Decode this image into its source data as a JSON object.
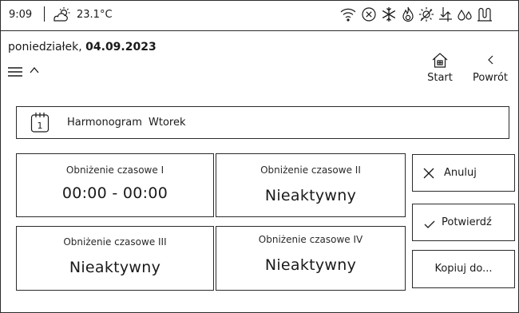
{
  "status_bar": {
    "time": "9:09",
    "temperature": "23.1°C",
    "icons": [
      "partly-sunny-icon",
      "wifi-icon",
      "error-circle-icon",
      "snowflake-icon",
      "flame-icon",
      "sun-off-icon",
      "airflow-icon",
      "water-drops-icon",
      "heat-exchanger-icon"
    ]
  },
  "header": {
    "weekday": "poniedziałek,",
    "date": "04.09.2023",
    "start_label": "Start",
    "back_label": "Powrót"
  },
  "schedule": {
    "calendar_day": "1",
    "title": "Harmonogram",
    "day": "Wtorek"
  },
  "reductions": [
    {
      "label": "Obniżenie czasowe I",
      "value": "00:00 - 00:00"
    },
    {
      "label": "Obniżenie czasowe II",
      "value": "Nieaktywny"
    },
    {
      "label": "Obniżenie czasowe III",
      "value": "Nieaktywny"
    },
    {
      "label": "Obniżenie czasowe IV",
      "value": "Nieaktywny"
    }
  ],
  "actions": {
    "cancel_label": "Anuluj",
    "confirm_label": "Potwierdź",
    "copy_label": "Kopiuj do..."
  },
  "colors": {
    "line": "#2b2b2b",
    "text": "#1a1a1a",
    "background": "#ffffff"
  }
}
